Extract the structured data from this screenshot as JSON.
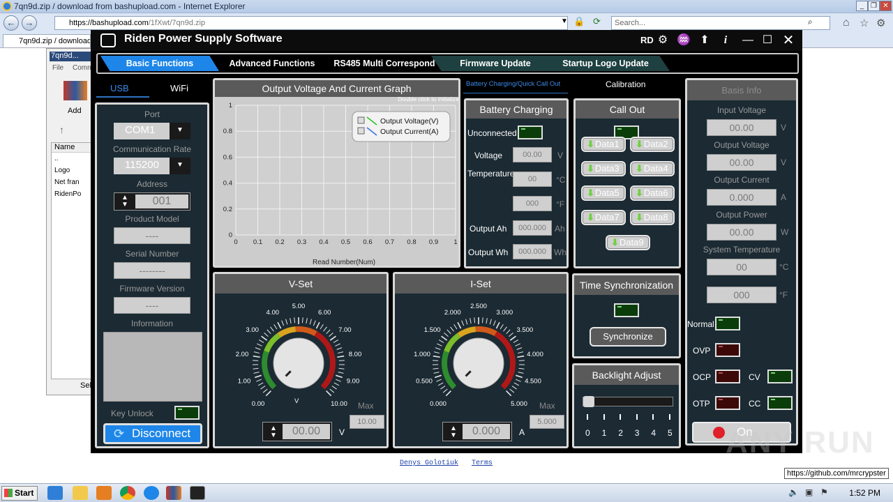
{
  "ie": {
    "title": "7qn9d.zip / download from bashupload.com - Internet Explorer",
    "url_host": "https://bashupload.com",
    "url_path": "/1fXwt/7qn9d.zip",
    "search_placeholder": "Search...",
    "tab_label": "7qn9d.zip / download ..."
  },
  "winrar": {
    "title": "7qn9d...",
    "menu_file": "File",
    "menu_commands": "Comm",
    "add_label": "Add",
    "col_name": "Name",
    "files": [
      "..",
      "Logo",
      "Net fran",
      "RidenPo"
    ],
    "status": "Sel"
  },
  "riden": {
    "title": "Riden Power Supply Software",
    "rd": "RD",
    "tabs": [
      "Basic Functions",
      "Advanced Functions",
      "RS485 Multi Correspond",
      "Firmware Update",
      "Startup Logo Update"
    ],
    "active_tab": "Basic Functions",
    "conn_tabs": [
      "USB",
      "WiFi"
    ],
    "conn": {
      "port_label": "Port",
      "port_value": "COM1",
      "rate_label": "Communication Rate",
      "rate_value": "115200",
      "address_label": "Address",
      "address_value": "001",
      "model_label": "Product Model",
      "model_value": "----",
      "serial_label": "Serial Number",
      "serial_value": "--------",
      "fw_label": "Firmware Version",
      "fw_value": "----",
      "info_label": "Information",
      "key_unlock": "Key Unlock",
      "disconnect": "Disconnect"
    },
    "graph": {
      "title": "Output Voltage And Current Graph",
      "hint": "Double click to initialize",
      "xlabel": "Read Number(Num)",
      "legend": [
        "Output Voltage(V)",
        "Output Current(A)"
      ],
      "x_ticks": [
        "0",
        "0.1",
        "0.2",
        "0.3",
        "0.4",
        "0.5",
        "0.6",
        "0.7",
        "0.8",
        "0.9",
        "1"
      ],
      "y_ticks": [
        "0",
        "0.2",
        "0.4",
        "0.6",
        "0.8",
        "1"
      ]
    },
    "subtabs": [
      "Battery Charging/Quick Call Out",
      "Calibration"
    ],
    "battery": {
      "title": "Battery Charging",
      "status": "Unconnected",
      "voltage_label": "Voltage",
      "voltage_value": "00.00",
      "voltage_unit": "V",
      "temp_label": "Temperature",
      "temp_c_value": "00",
      "temp_c_unit": "°C",
      "temp_f_value": "000",
      "temp_f_unit": "°F",
      "ah_label": "Output Ah",
      "ah_value": "000.000",
      "ah_unit": "Ah",
      "wh_label": "Output Wh",
      "wh_value": "000.000",
      "wh_unit": "Wh"
    },
    "callout": {
      "title": "Call Out",
      "buttons": [
        "Data1",
        "Data2",
        "Data3",
        "Data4",
        "Data5",
        "Data6",
        "Data7",
        "Data8",
        "Data9"
      ]
    },
    "basis": {
      "title": "Basis Info",
      "input_voltage_label": "Input Voltage",
      "input_voltage": "00.00",
      "output_voltage_label": "Output Voltage",
      "output_voltage": "00.00",
      "output_current_label": "Output Current",
      "output_current": "0.000",
      "output_power_label": "Output Power",
      "output_power": "00.00",
      "sys_temp_label": "System Temperature",
      "sys_temp_c": "00",
      "sys_temp_f": "000",
      "u_v": "V",
      "u_a": "A",
      "u_w": "W",
      "u_c": "°C",
      "u_f": "°F",
      "normal": "Normal",
      "ovp": "OVP",
      "ocp": "OCP",
      "otp": "OTP",
      "cv": "CV",
      "cc": "CC",
      "on": "On"
    },
    "vset": {
      "title": "V-Set",
      "ticks": [
        "0.00",
        "1.00",
        "2.00",
        "3.00",
        "4.00",
        "5.00",
        "6.00",
        "7.00",
        "8.00",
        "9.00",
        "10.00"
      ],
      "unit_dial": "V",
      "max_label": "Max",
      "max_value": "10.00",
      "value": "00.00",
      "unit": "V"
    },
    "iset": {
      "title": "I-Set",
      "ticks": [
        "0.000",
        "0.500",
        "1.000",
        "1.500",
        "2.000",
        "2.500",
        "3.000",
        "3.500",
        "4.000",
        "4.500",
        "5.000"
      ],
      "max_label": "Max",
      "max_value": "5.000",
      "value": "0.000",
      "unit": "A"
    },
    "timesync": {
      "title": "Time Synchronization",
      "button": "Synchronize"
    },
    "backlight": {
      "title": "Backlight Adjust",
      "level": 0,
      "ticks": [
        "0",
        "1",
        "2",
        "3",
        "4",
        "5"
      ]
    }
  },
  "page": {
    "credit_author": "Denys Golotiuk",
    "credit_terms": "Terms",
    "tooltip": "https://github.com/mrcrypster"
  },
  "taskbar": {
    "start": "Start",
    "time": "1:52 PM"
  },
  "watermark": "ANY RUN"
}
